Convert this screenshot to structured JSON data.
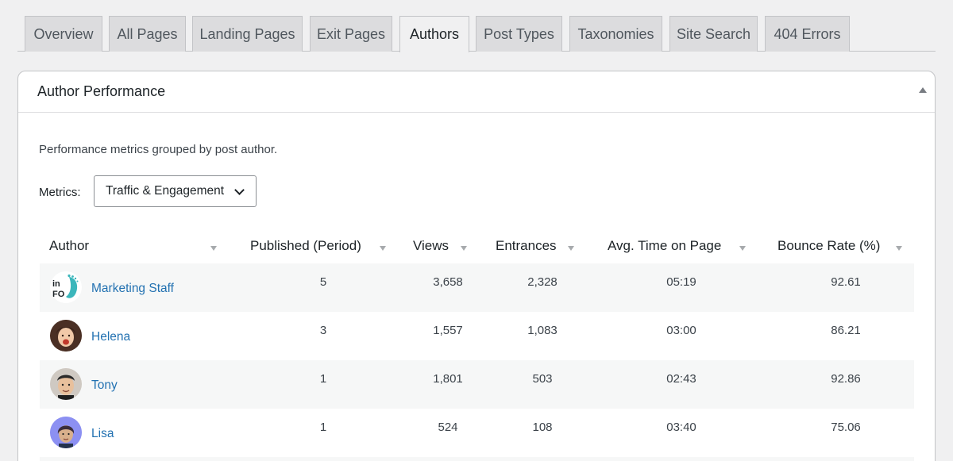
{
  "tabs": [
    {
      "label": "Overview"
    },
    {
      "label": "All Pages"
    },
    {
      "label": "Landing Pages"
    },
    {
      "label": "Exit Pages"
    },
    {
      "label": "Authors",
      "active": true
    },
    {
      "label": "Post Types"
    },
    {
      "label": "Taxonomies"
    },
    {
      "label": "Site Search"
    },
    {
      "label": "404 Errors"
    }
  ],
  "panel": {
    "title": "Author Performance",
    "description": "Performance metrics grouped by post author.",
    "metrics_label": "Metrics:",
    "metrics_selected": "Traffic & Engagement"
  },
  "table": {
    "columns": [
      "Author",
      "Published (Period)",
      "Views",
      "Entrances",
      "Avg. Time on Page",
      "Bounce Rate (%)"
    ],
    "rows": [
      {
        "author": "Marketing Staff",
        "published": "5",
        "views": "3,658",
        "entrances": "2,328",
        "avg_time": "05:19",
        "bounce": "92.61",
        "logo_text_top": "in",
        "logo_text_bottom": "FO"
      },
      {
        "author": "Helena",
        "published": "3",
        "views": "1,557",
        "entrances": "1,083",
        "avg_time": "03:00",
        "bounce": "86.21"
      },
      {
        "author": "Tony",
        "published": "1",
        "views": "1,801",
        "entrances": "503",
        "avg_time": "02:43",
        "bounce": "92.86"
      },
      {
        "author": "Lisa",
        "published": "1",
        "views": "524",
        "entrances": "108",
        "avg_time": "03:40",
        "bounce": "75.06"
      }
    ]
  },
  "colors": {
    "link": "#2271b1",
    "tab_bg": "#dcdcde",
    "row_alt": "#f6f7f7",
    "logo_teal": "#3bb6bb"
  }
}
